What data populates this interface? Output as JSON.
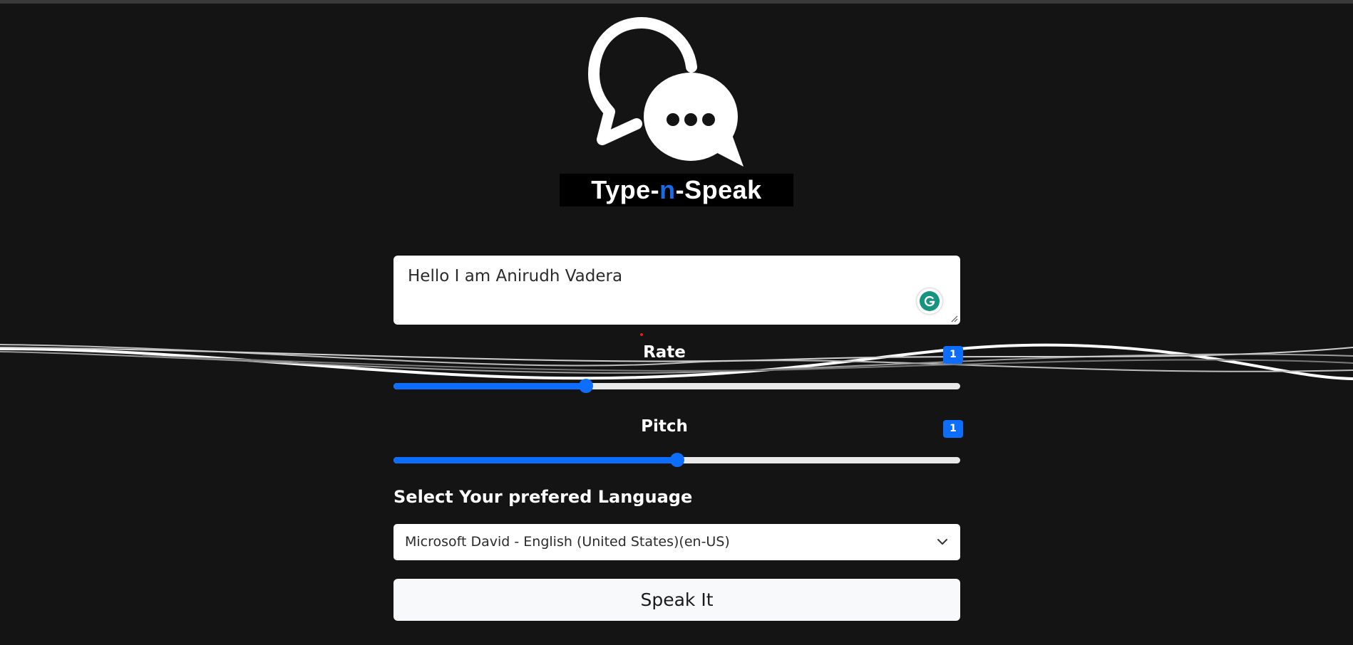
{
  "app": {
    "logo_text_before": "Type-",
    "logo_text_accent": "n",
    "logo_text_after": "-Speak",
    "accent_color": "#0d6efd",
    "background_color": "#141414"
  },
  "text_input": {
    "value": "Hello I am Anirudh Vadera"
  },
  "rate": {
    "label": "Rate",
    "value": "1",
    "fill_fraction": 0.34
  },
  "pitch": {
    "label": "Pitch",
    "value": "1",
    "fill_fraction": 0.5
  },
  "language": {
    "label": "Select Your prefered Language",
    "selected": "Microsoft David - English (United States)(en-US)"
  },
  "speak_button": {
    "label": "Speak It"
  },
  "icons": {
    "logo": "chat-bubbles-icon",
    "grammarly": "grammarly-icon",
    "select_arrow": "chevron-down-icon"
  }
}
